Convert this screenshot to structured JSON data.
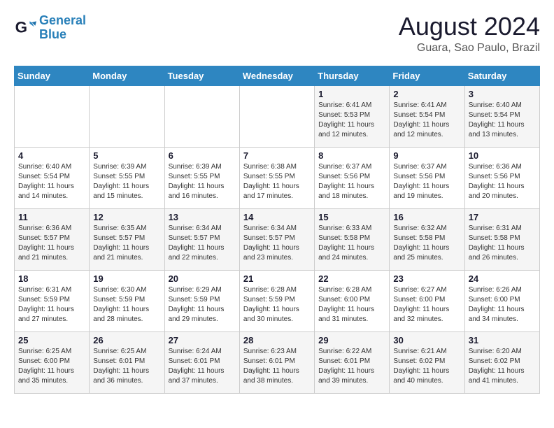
{
  "header": {
    "logo_line1": "General",
    "logo_line2": "Blue",
    "month_title": "August 2024",
    "location": "Guara, Sao Paulo, Brazil"
  },
  "weekdays": [
    "Sunday",
    "Monday",
    "Tuesday",
    "Wednesday",
    "Thursday",
    "Friday",
    "Saturday"
  ],
  "weeks": [
    [
      {
        "day": "",
        "sunrise": "",
        "sunset": "",
        "daylight": ""
      },
      {
        "day": "",
        "sunrise": "",
        "sunset": "",
        "daylight": ""
      },
      {
        "day": "",
        "sunrise": "",
        "sunset": "",
        "daylight": ""
      },
      {
        "day": "",
        "sunrise": "",
        "sunset": "",
        "daylight": ""
      },
      {
        "day": "1",
        "sunrise": "Sunrise: 6:41 AM",
        "sunset": "Sunset: 5:53 PM",
        "daylight": "Daylight: 11 hours and 12 minutes."
      },
      {
        "day": "2",
        "sunrise": "Sunrise: 6:41 AM",
        "sunset": "Sunset: 5:54 PM",
        "daylight": "Daylight: 11 hours and 12 minutes."
      },
      {
        "day": "3",
        "sunrise": "Sunrise: 6:40 AM",
        "sunset": "Sunset: 5:54 PM",
        "daylight": "Daylight: 11 hours and 13 minutes."
      }
    ],
    [
      {
        "day": "4",
        "sunrise": "Sunrise: 6:40 AM",
        "sunset": "Sunset: 5:54 PM",
        "daylight": "Daylight: 11 hours and 14 minutes."
      },
      {
        "day": "5",
        "sunrise": "Sunrise: 6:39 AM",
        "sunset": "Sunset: 5:55 PM",
        "daylight": "Daylight: 11 hours and 15 minutes."
      },
      {
        "day": "6",
        "sunrise": "Sunrise: 6:39 AM",
        "sunset": "Sunset: 5:55 PM",
        "daylight": "Daylight: 11 hours and 16 minutes."
      },
      {
        "day": "7",
        "sunrise": "Sunrise: 6:38 AM",
        "sunset": "Sunset: 5:55 PM",
        "daylight": "Daylight: 11 hours and 17 minutes."
      },
      {
        "day": "8",
        "sunrise": "Sunrise: 6:37 AM",
        "sunset": "Sunset: 5:56 PM",
        "daylight": "Daylight: 11 hours and 18 minutes."
      },
      {
        "day": "9",
        "sunrise": "Sunrise: 6:37 AM",
        "sunset": "Sunset: 5:56 PM",
        "daylight": "Daylight: 11 hours and 19 minutes."
      },
      {
        "day": "10",
        "sunrise": "Sunrise: 6:36 AM",
        "sunset": "Sunset: 5:56 PM",
        "daylight": "Daylight: 11 hours and 20 minutes."
      }
    ],
    [
      {
        "day": "11",
        "sunrise": "Sunrise: 6:36 AM",
        "sunset": "Sunset: 5:57 PM",
        "daylight": "Daylight: 11 hours and 21 minutes."
      },
      {
        "day": "12",
        "sunrise": "Sunrise: 6:35 AM",
        "sunset": "Sunset: 5:57 PM",
        "daylight": "Daylight: 11 hours and 21 minutes."
      },
      {
        "day": "13",
        "sunrise": "Sunrise: 6:34 AM",
        "sunset": "Sunset: 5:57 PM",
        "daylight": "Daylight: 11 hours and 22 minutes."
      },
      {
        "day": "14",
        "sunrise": "Sunrise: 6:34 AM",
        "sunset": "Sunset: 5:57 PM",
        "daylight": "Daylight: 11 hours and 23 minutes."
      },
      {
        "day": "15",
        "sunrise": "Sunrise: 6:33 AM",
        "sunset": "Sunset: 5:58 PM",
        "daylight": "Daylight: 11 hours and 24 minutes."
      },
      {
        "day": "16",
        "sunrise": "Sunrise: 6:32 AM",
        "sunset": "Sunset: 5:58 PM",
        "daylight": "Daylight: 11 hours and 25 minutes."
      },
      {
        "day": "17",
        "sunrise": "Sunrise: 6:31 AM",
        "sunset": "Sunset: 5:58 PM",
        "daylight": "Daylight: 11 hours and 26 minutes."
      }
    ],
    [
      {
        "day": "18",
        "sunrise": "Sunrise: 6:31 AM",
        "sunset": "Sunset: 5:59 PM",
        "daylight": "Daylight: 11 hours and 27 minutes."
      },
      {
        "day": "19",
        "sunrise": "Sunrise: 6:30 AM",
        "sunset": "Sunset: 5:59 PM",
        "daylight": "Daylight: 11 hours and 28 minutes."
      },
      {
        "day": "20",
        "sunrise": "Sunrise: 6:29 AM",
        "sunset": "Sunset: 5:59 PM",
        "daylight": "Daylight: 11 hours and 29 minutes."
      },
      {
        "day": "21",
        "sunrise": "Sunrise: 6:28 AM",
        "sunset": "Sunset: 5:59 PM",
        "daylight": "Daylight: 11 hours and 30 minutes."
      },
      {
        "day": "22",
        "sunrise": "Sunrise: 6:28 AM",
        "sunset": "Sunset: 6:00 PM",
        "daylight": "Daylight: 11 hours and 31 minutes."
      },
      {
        "day": "23",
        "sunrise": "Sunrise: 6:27 AM",
        "sunset": "Sunset: 6:00 PM",
        "daylight": "Daylight: 11 hours and 32 minutes."
      },
      {
        "day": "24",
        "sunrise": "Sunrise: 6:26 AM",
        "sunset": "Sunset: 6:00 PM",
        "daylight": "Daylight: 11 hours and 34 minutes."
      }
    ],
    [
      {
        "day": "25",
        "sunrise": "Sunrise: 6:25 AM",
        "sunset": "Sunset: 6:00 PM",
        "daylight": "Daylight: 11 hours and 35 minutes."
      },
      {
        "day": "26",
        "sunrise": "Sunrise: 6:25 AM",
        "sunset": "Sunset: 6:01 PM",
        "daylight": "Daylight: 11 hours and 36 minutes."
      },
      {
        "day": "27",
        "sunrise": "Sunrise: 6:24 AM",
        "sunset": "Sunset: 6:01 PM",
        "daylight": "Daylight: 11 hours and 37 minutes."
      },
      {
        "day": "28",
        "sunrise": "Sunrise: 6:23 AM",
        "sunset": "Sunset: 6:01 PM",
        "daylight": "Daylight: 11 hours and 38 minutes."
      },
      {
        "day": "29",
        "sunrise": "Sunrise: 6:22 AM",
        "sunset": "Sunset: 6:01 PM",
        "daylight": "Daylight: 11 hours and 39 minutes."
      },
      {
        "day": "30",
        "sunrise": "Sunrise: 6:21 AM",
        "sunset": "Sunset: 6:02 PM",
        "daylight": "Daylight: 11 hours and 40 minutes."
      },
      {
        "day": "31",
        "sunrise": "Sunrise: 6:20 AM",
        "sunset": "Sunset: 6:02 PM",
        "daylight": "Daylight: 11 hours and 41 minutes."
      }
    ]
  ]
}
